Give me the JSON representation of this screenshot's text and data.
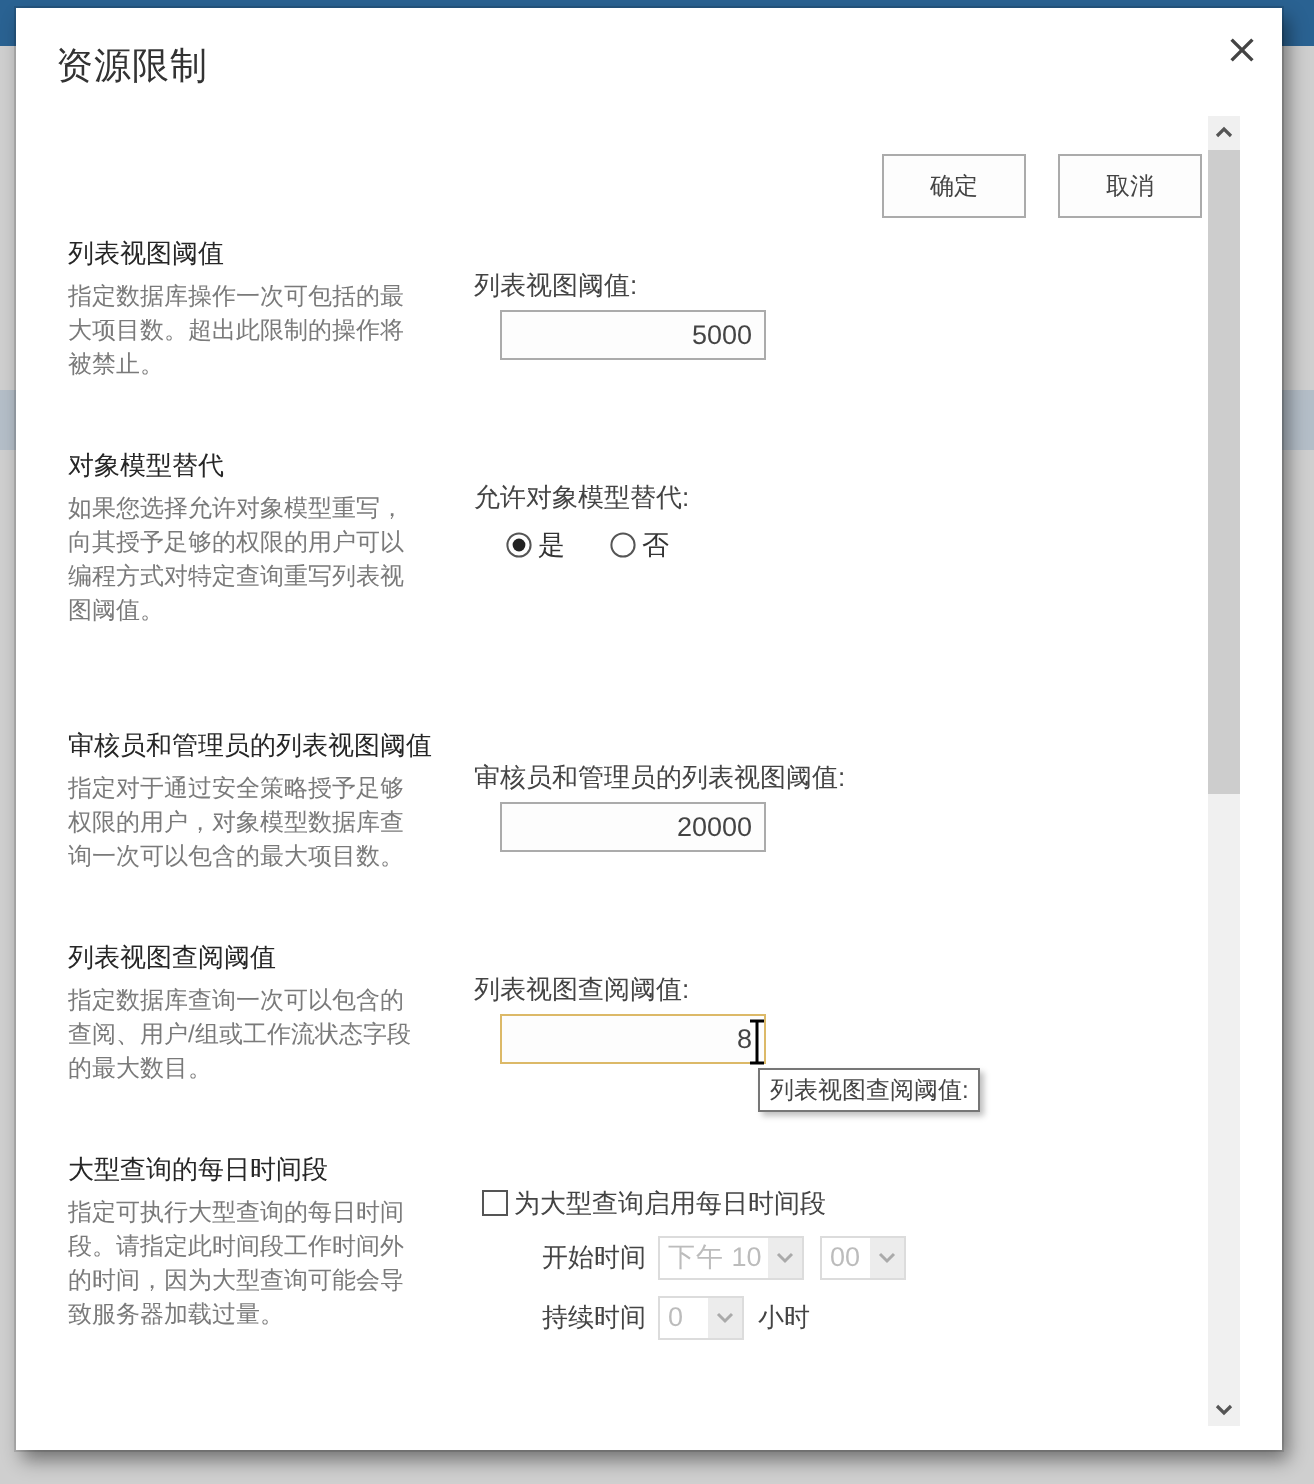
{
  "dialog": {
    "title": "资源限制",
    "buttons": [
      "确定",
      "取消"
    ]
  },
  "sections": [
    {
      "kind": "number",
      "title": "列表视图阈值",
      "description": "指定数据库操作一次可包括的最大项目数。超出此限制的操作将被禁止。",
      "field_label": "列表视图阈值:",
      "value": "5000",
      "focused": false
    },
    {
      "kind": "radio",
      "title": "对象模型替代",
      "description": "如果您选择允许对象模型重写，向其授予足够的权限的用户可以编程方式对特定查询重写列表视图阈值。",
      "field_label": "允许对象模型替代:",
      "options": [
        {
          "label": "是",
          "selected": true
        },
        {
          "label": "否",
          "selected": false
        }
      ]
    },
    {
      "kind": "number",
      "title": "审核员和管理员的列表视图阈值",
      "description": "指定对于通过安全策略授予足够权限的用户，对象模型数据库查询一次可以包含的最大项目数。",
      "field_label": "审核员和管理员的列表视图阈值:",
      "value": "20000",
      "focused": false
    },
    {
      "kind": "number",
      "title": "列表视图查阅阈值",
      "description": "指定数据库查询一次可以包含的查阅、用户/组或工作流状态字段的最大数目。",
      "field_label": "列表视图查阅阈值:",
      "value": "8",
      "focused": true,
      "tooltip": "列表视图查阅阈值:"
    },
    {
      "kind": "schedule",
      "title": "大型查询的每日时间段",
      "description": "指定可执行大型查询的每日时间段。请指定此时间段工作时间外的时间，因为大型查询可能会导致服务器加载过量。",
      "checkbox": {
        "label": "为大型查询启用每日时间段",
        "checked": false
      },
      "start": {
        "label": "开始时间",
        "hour": "下午 10",
        "minute": "00",
        "disabled": true
      },
      "duration": {
        "label": "持续时间",
        "value": "0",
        "unit": "小时",
        "disabled": true
      }
    }
  ]
}
